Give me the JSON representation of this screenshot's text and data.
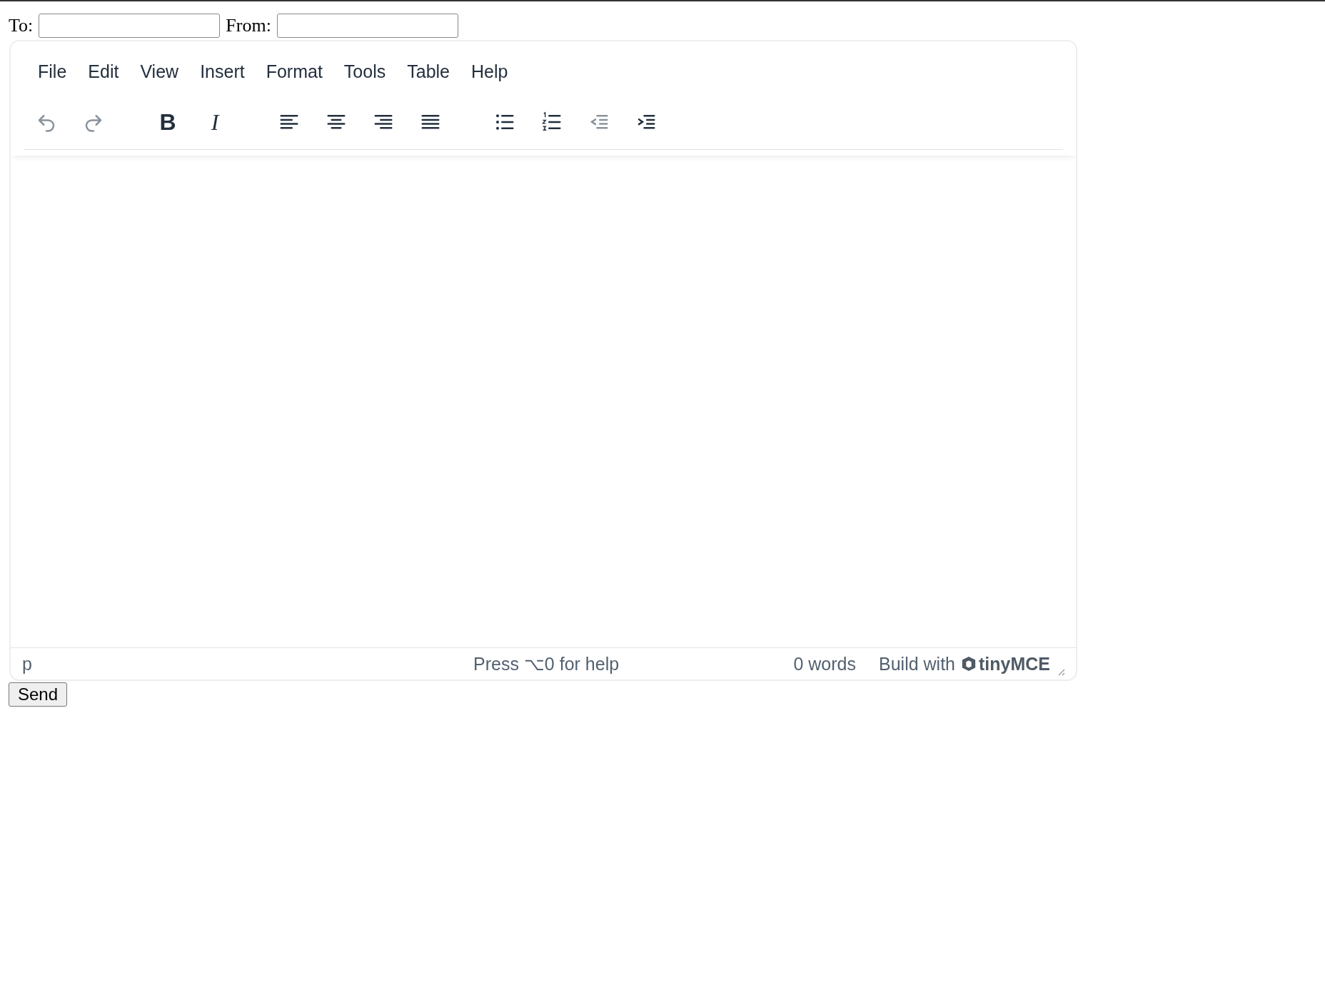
{
  "to_field": {
    "label": "To:"
  },
  "from_field": {
    "label": "From:"
  },
  "editor": {
    "menubar": [
      "File",
      "Edit",
      "View",
      "Insert",
      "Format",
      "Tools",
      "Table",
      "Help"
    ],
    "toolbar": [
      [
        {
          "kind": "undo",
          "disabled": true
        },
        {
          "kind": "redo",
          "disabled": true
        }
      ],
      [
        {
          "kind": "bold",
          "label": "B",
          "disabled": false
        },
        {
          "kind": "italic",
          "label": "I",
          "disabled": false
        }
      ],
      [
        {
          "kind": "align-left",
          "disabled": false
        },
        {
          "kind": "align-center",
          "disabled": false
        },
        {
          "kind": "align-right",
          "disabled": false
        },
        {
          "kind": "align-justify",
          "disabled": false
        }
      ],
      [
        {
          "kind": "bullet-list",
          "disabled": false
        },
        {
          "kind": "numbered-list",
          "disabled": false
        },
        {
          "kind": "outdent",
          "disabled": true
        },
        {
          "kind": "indent",
          "disabled": false
        }
      ]
    ],
    "status_bar": {
      "path": "p",
      "help": "Press ⌥0 for help",
      "word_count": "0 words",
      "branding": "Build with",
      "logo": "tinyMCE"
    }
  },
  "send_button": "Send"
}
